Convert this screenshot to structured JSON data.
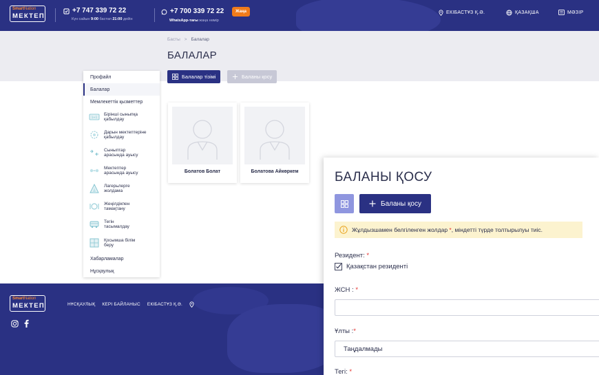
{
  "header": {
    "logo_top_1": "Smart",
    "logo_top_2": "Nation",
    "logo_main": "МЕКТЕП",
    "phone1": "+7 747 339 72 22",
    "phone1_hours_prefix": "Күн сайын",
    "phone1_hours_from": "9:00",
    "phone1_hours_mid": "бастап",
    "phone1_hours_to": "21:00",
    "phone1_hours_suffix": "дейін",
    "phone2": "+7 700 339 72 22",
    "phone2_badge": "Жаңа",
    "phone2_sub_bold": "WhatsApp-тағы",
    "phone2_sub_rest": "жаңа нөмір",
    "city": "ЕКІБАСТҰЗ Қ.Ә.",
    "language": "ҚАЗАҚША",
    "menu": "МӘЗІР"
  },
  "breadcrumb": {
    "home": "Басты",
    "current": "Балалар"
  },
  "page_title": "БАЛАЛАР",
  "tabs": {
    "list": "Балалар тізімі",
    "add": "Баланы қосу"
  },
  "sidebar": {
    "profile": "Профайл",
    "children": "Балалар",
    "gov_services": "Мемлекеттік қызметтер",
    "services": [
      {
        "line1": "Бірінші сыныпқа",
        "line2": "қабылдау",
        "icon": "first-grade-icon"
      },
      {
        "line1": "Дарын мектептеріне",
        "line2": "қабылдау",
        "icon": "gifted-school-icon"
      },
      {
        "line1": "Сыныптар",
        "line2": "арасында ауысу",
        "icon": "class-transfer-icon"
      },
      {
        "line1": "Мектептер",
        "line2": "арасында ауысу",
        "icon": "school-transfer-icon"
      },
      {
        "line1": "Лагерьлерге",
        "line2": "жолдама",
        "icon": "camp-icon"
      },
      {
        "line1": "Жеңілдікпен",
        "line2": "тамақтану",
        "icon": "meal-icon"
      },
      {
        "line1": "Тегін",
        "line2": "тасымалдау",
        "icon": "bus-icon"
      },
      {
        "line1": "Қосымша білім",
        "line2": "беру",
        "icon": "extra-education-icon"
      }
    ],
    "messages": "Хабарламалар",
    "guide": "Нұсқаулық"
  },
  "children": [
    {
      "name": "Болатов Болат"
    },
    {
      "name": "Болатова Айкөркем"
    }
  ],
  "footer": {
    "logo_top_1": "Smart",
    "logo_top_2": "Nation",
    "logo_main": "МЕКТЕП",
    "link_guide": "НҰСҚАУЛЫҚ",
    "link_feedback": "КЕРІ БАЙЛАНЫС",
    "link_city": "ЕКІБАСТҰЗ Қ.Ә."
  },
  "panel": {
    "title": "БАЛАНЫ ҚОСУ",
    "add_button": "Баланы қосу",
    "notice_before": "Жұлдызшамен белгіленген жолдар",
    "notice_star": "*",
    "notice_after": ", міндетті түрде толтырылуы тиіс.",
    "resident_label": "Резидент:",
    "resident_checkbox": "Қазақстан резиденті",
    "iin_label": "ЖСН :",
    "iin_value": "",
    "nationality_label": "Ұлты :",
    "nationality_value": "Таңдалмады",
    "surname_label": "Тегі:",
    "required_mark": "*"
  },
  "colors": {
    "brand": "#2a3183",
    "accent_orange": "#f07b1a",
    "required_red": "#e5322e",
    "notice_bg": "#fcf3cf",
    "grid_button": "#8f96df"
  }
}
